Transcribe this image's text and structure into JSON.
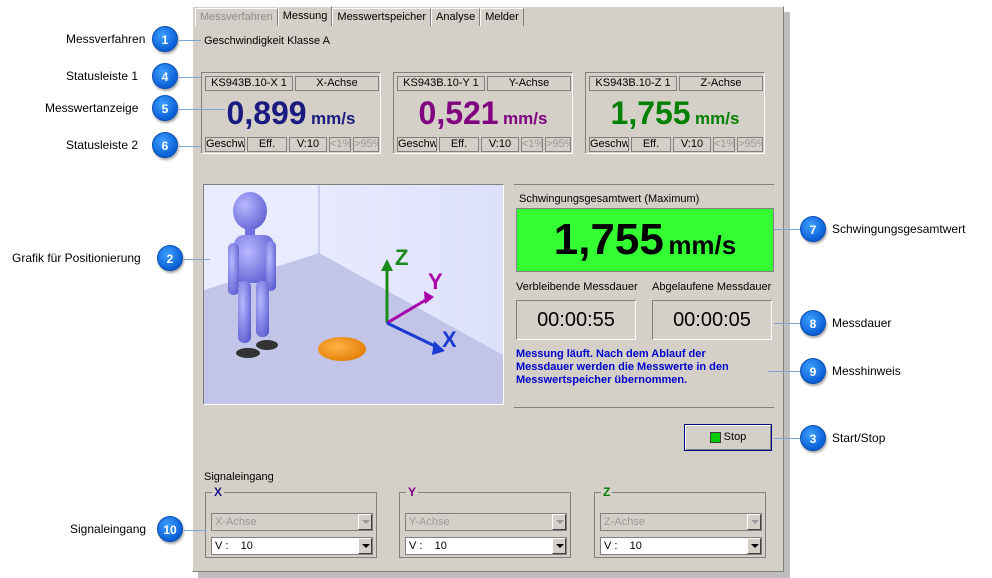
{
  "tabs": [
    {
      "label": "Messverfahren",
      "state": "disabled"
    },
    {
      "label": "Messung",
      "state": "active"
    },
    {
      "label": "Messwertspeicher",
      "state": "normal"
    },
    {
      "label": "Analyse",
      "state": "normal"
    },
    {
      "label": "Melder",
      "state": "normal"
    }
  ],
  "method": {
    "text": "Geschwindigkeit Klasse A"
  },
  "channels": [
    {
      "sensor": "KS943B.10-X 1",
      "axis": "X-Achse",
      "value": "0,899",
      "unit": "mm/s",
      "color": "#1a1a80",
      "status": [
        "Geschw",
        "Eff.",
        "V:10",
        "<1%",
        ">95%"
      ]
    },
    {
      "sensor": "KS943B.10-Y 1",
      "axis": "Y-Achse",
      "value": "0,521",
      "unit": "mm/s",
      "color": "#800080",
      "status": [
        "Geschw",
        "Eff.",
        "V:10",
        "<1%",
        ">95%"
      ]
    },
    {
      "sensor": "KS943B.10-Z 1",
      "axis": "Z-Achse",
      "value": "1,755",
      "unit": "mm/s",
      "color": "#008000",
      "status": [
        "Geschw",
        "Eff.",
        "V:10",
        "<1%",
        ">95%"
      ]
    }
  ],
  "total": {
    "title": "Schwingungsgesamtwert (Maximum)",
    "value": "1,755",
    "unit": "mm/s",
    "bg": "#33ff33"
  },
  "durations": {
    "remaining_label": "Verbleibende Messdauer",
    "remaining": "00:00:55",
    "elapsed_label": "Abgelaufene Messdauer",
    "elapsed": "00:00:05"
  },
  "hint": {
    "text": "Messung läuft. Nach dem Ablauf der Messdauer werden die Messwerte in den Messwertspeicher übernommen.",
    "color": "#0000cc"
  },
  "stop_button": {
    "label": "Stop",
    "led": "#00cc00"
  },
  "signal": {
    "title": "Signaleingang",
    "groups": [
      {
        "name": "X",
        "color": "#1a1a80",
        "axis": "X-Achse",
        "gain": "V :    10"
      },
      {
        "name": "Y",
        "color": "#800080",
        "axis": "Y-Achse",
        "gain": "V :    10"
      },
      {
        "name": "Z",
        "color": "#008000",
        "axis": "Z-Achse",
        "gain": "V :    10"
      }
    ]
  },
  "graphic_axes": {
    "x": "X",
    "y": "Y",
    "z": "Z"
  },
  "callouts": [
    {
      "num": "1",
      "label": "Messverfahren"
    },
    {
      "num": "4",
      "label": "Statusleiste 1"
    },
    {
      "num": "5",
      "label": "Messwertanzeige"
    },
    {
      "num": "6",
      "label": "Statusleiste 2"
    },
    {
      "num": "2",
      "label": "Grafik für Positionierung"
    },
    {
      "num": "10",
      "label": "Signaleingang"
    },
    {
      "num": "7",
      "label": "Schwingungsgesamtwert"
    },
    {
      "num": "8",
      "label": "Messdauer"
    },
    {
      "num": "9",
      "label": "Messhinweis"
    },
    {
      "num": "3",
      "label": "Start/Stop"
    }
  ],
  "icons": [
    "figure-graphic",
    "axis-cross-icon",
    "position-disc-icon",
    "led-icon",
    "dropdown-arrow-icon"
  ]
}
